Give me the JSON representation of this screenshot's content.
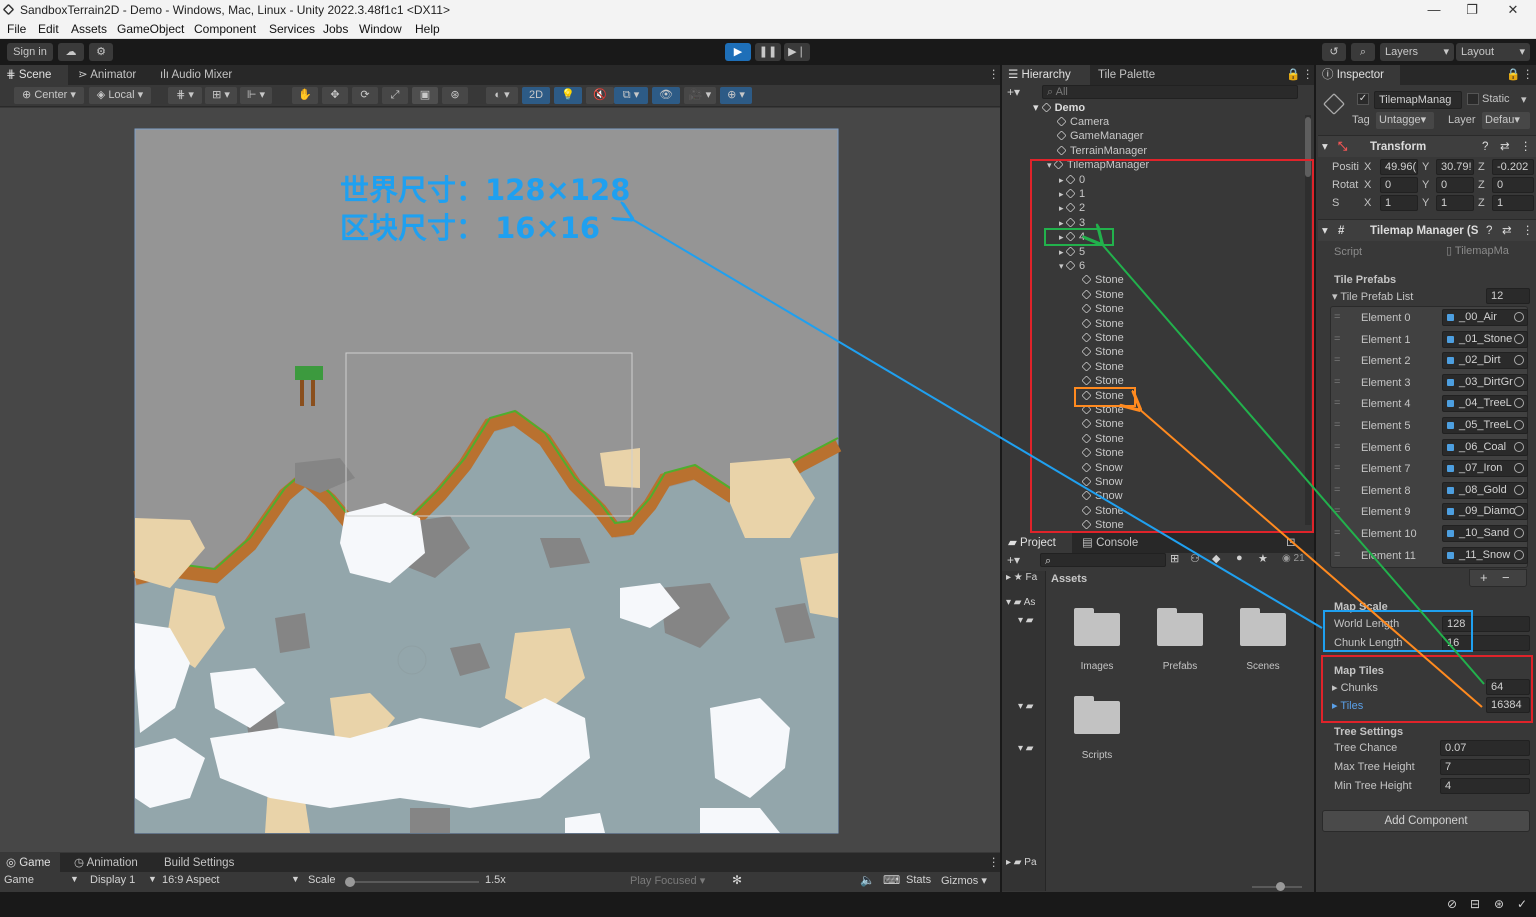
{
  "window": {
    "title": "SandboxTerrain2D - Demo - Windows, Mac, Linux - Unity 2022.3.48f1c1 <DX11>",
    "controls": [
      "—",
      "❐",
      "✕"
    ]
  },
  "menu": [
    "File",
    "Edit",
    "Assets",
    "GameObject",
    "Component",
    "Services",
    "Jobs",
    "Window",
    "Help"
  ],
  "toolbar": {
    "sign_in": "Sign in",
    "play_icon": "play-icon",
    "layers": "Layers",
    "layout": "Layout"
  },
  "scene_tabs": [
    "Scene",
    "Animator",
    "Audio Mixer"
  ],
  "scene_toolbar": {
    "pivot": "Center",
    "space": "Local",
    "mode_2d": "2D"
  },
  "annotation": {
    "line1": "世界尺寸：128×128",
    "line2": "区块尺寸：   16×16",
    "color": "#1fa0f0"
  },
  "hierarchy": {
    "tabs": [
      "Hierarchy",
      "Tile Palette"
    ],
    "search_placeholder": "All",
    "scene": "Demo",
    "rows": [
      {
        "label": "Camera"
      },
      {
        "label": "GameManager"
      },
      {
        "label": "TerrainManager"
      },
      {
        "label": "TilemapManager"
      },
      {
        "label": "0"
      },
      {
        "label": "1"
      },
      {
        "label": "2"
      },
      {
        "label": "3"
      },
      {
        "label": "4"
      },
      {
        "label": "5"
      },
      {
        "label": "6"
      },
      {
        "label": "Stone"
      },
      {
        "label": "Stone"
      },
      {
        "label": "Stone"
      },
      {
        "label": "Stone"
      },
      {
        "label": "Stone"
      },
      {
        "label": "Stone"
      },
      {
        "label": "Stone"
      },
      {
        "label": "Stone"
      },
      {
        "label": "Stone"
      },
      {
        "label": "Stone"
      },
      {
        "label": "Stone"
      },
      {
        "label": "Stone"
      },
      {
        "label": "Stone"
      },
      {
        "label": "Snow"
      },
      {
        "label": "Snow"
      },
      {
        "label": "Snow"
      },
      {
        "label": "Stone"
      },
      {
        "label": "Stone"
      }
    ]
  },
  "project": {
    "tabs": [
      "Project",
      "Console"
    ],
    "breadcrumb": "Assets",
    "side_labels": [
      "Fa",
      "As",
      "Pa"
    ],
    "folders": [
      "Images",
      "Prefabs",
      "Scenes",
      "Scripts"
    ],
    "count": "21"
  },
  "inspector": {
    "tab": "Inspector",
    "object_name": "TilemapManag",
    "static": "Static",
    "tag_label": "Tag",
    "tag_value": "Untagge",
    "layer_label": "Layer",
    "layer_value": "Defau",
    "transform": {
      "title": "Transform",
      "rows": [
        {
          "label": "Positi",
          "x": "49.96(",
          "y": "30.79!",
          "z": "-0.202"
        },
        {
          "label": "Rotat",
          "x": "0",
          "y": "0",
          "z": "0"
        },
        {
          "label": "S",
          "x": "1",
          "y": "1",
          "z": "1"
        }
      ]
    },
    "component": {
      "title": "Tilemap Manager (S",
      "script_label": "Script",
      "script_value": "TilemapMa",
      "tile_prefabs_header": "Tile Prefabs",
      "list_label": "Tile Prefab List",
      "list_count": "12",
      "elements": [
        {
          "label": "Element 0",
          "value": "_00_Air"
        },
        {
          "label": "Element 1",
          "value": "_01_Stone"
        },
        {
          "label": "Element 2",
          "value": "_02_Dirt"
        },
        {
          "label": "Element 3",
          "value": "_03_DirtGr"
        },
        {
          "label": "Element 4",
          "value": "_04_TreeL"
        },
        {
          "label": "Element 5",
          "value": "_05_TreeL"
        },
        {
          "label": "Element 6",
          "value": "_06_Coal"
        },
        {
          "label": "Element 7",
          "value": "_07_Iron"
        },
        {
          "label": "Element 8",
          "value": "_08_Gold"
        },
        {
          "label": "Element 9",
          "value": "_09_Diamo"
        },
        {
          "label": "Element 10",
          "value": "_10_Sand"
        },
        {
          "label": "Element 11",
          "value": "_11_Snow"
        }
      ],
      "map_scale_header": "Map Scale",
      "world_length_label": "World Length",
      "world_length": "128",
      "chunk_length_label": "Chunk Length",
      "chunk_length": "16",
      "map_tiles_header": "Map Tiles",
      "chunks_label": "Chunks",
      "chunks": "64",
      "tiles_label": "Tiles",
      "tiles": "16384",
      "tree_header": "Tree Settings",
      "tree_chance_label": "Tree Chance",
      "tree_chance": "0.07",
      "max_tree_label": "Max Tree Height",
      "max_tree": "7",
      "min_tree_label": "Min Tree Height",
      "min_tree": "4"
    },
    "add_component": "Add Component"
  },
  "game_tabs": [
    "Game",
    "Animation",
    "Build Settings"
  ],
  "game_toolbar": {
    "mode": "Game",
    "display": "Display 1",
    "aspect": "16:9 Aspect",
    "scale_label": "Scale",
    "scale_value": "1.5x",
    "play_focused": "Play Focused",
    "stats": "Stats",
    "gizmos": "Gizmos"
  },
  "highlight_colors": {
    "red": "#e0232a",
    "green": "#22b14c",
    "orange": "#ff8a1f",
    "blue": "#1fa0f0"
  }
}
